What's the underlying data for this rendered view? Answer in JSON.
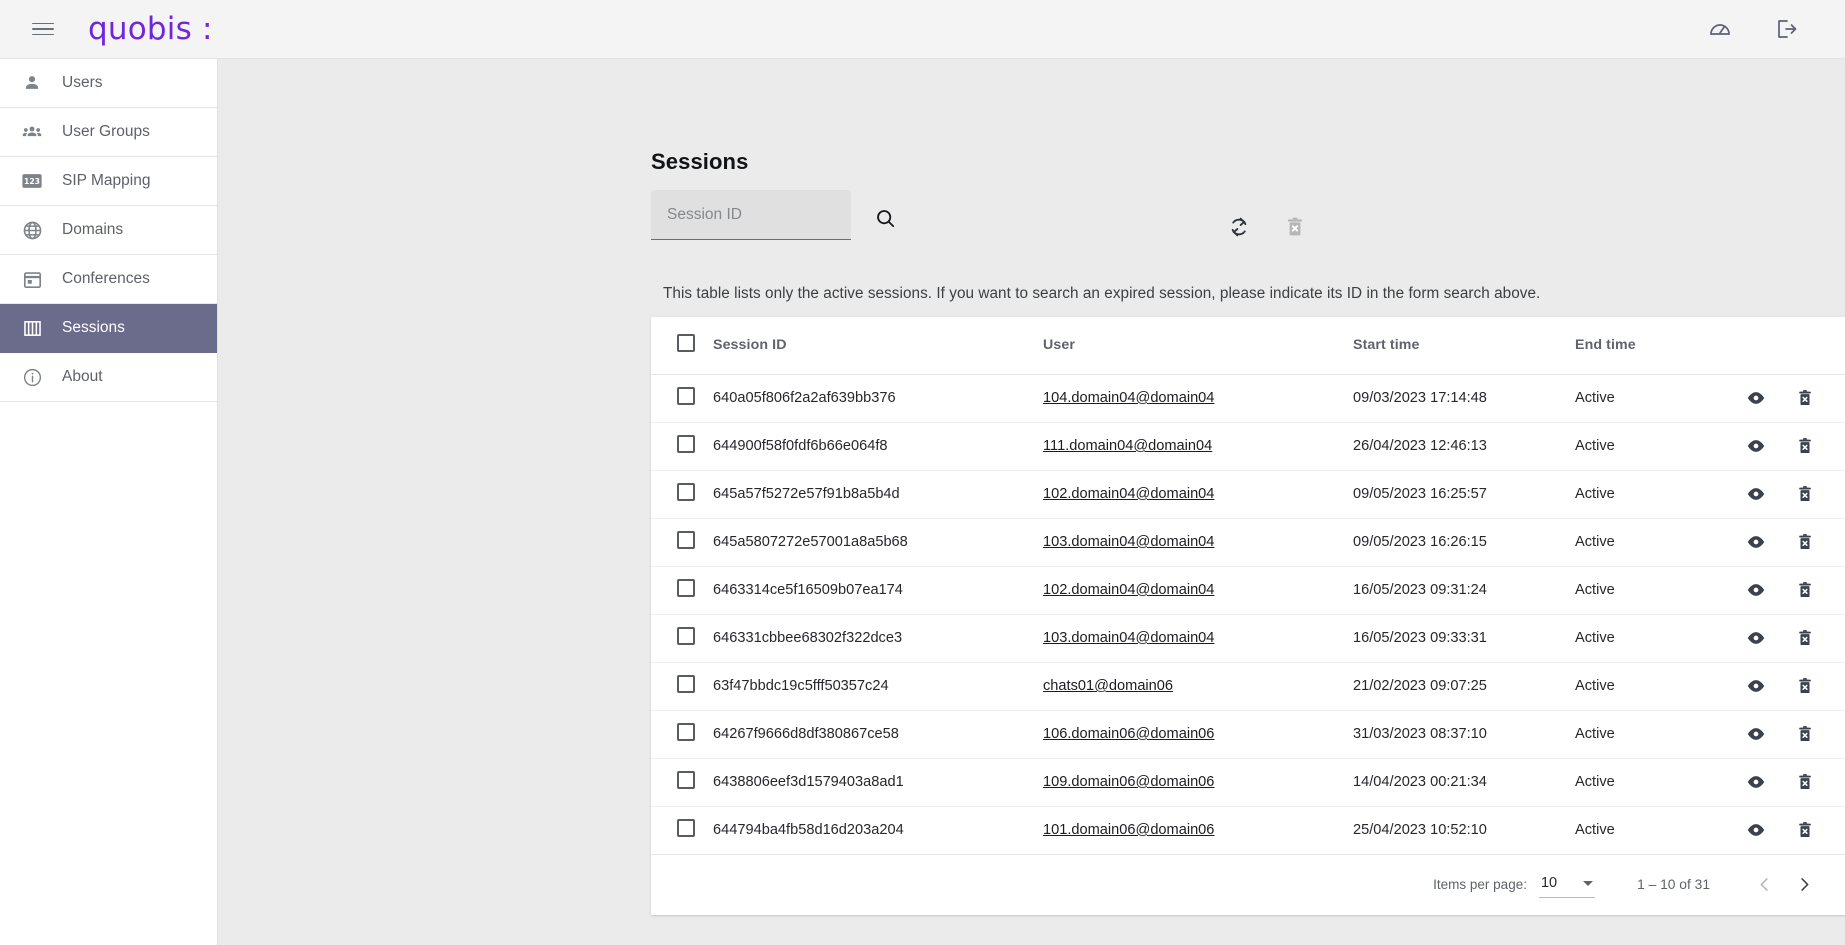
{
  "topbar": {
    "menu_icon": "hamburger-menu-icon",
    "brand": "quobis :",
    "icons": [
      {
        "name": "dashboard-gauge-icon",
        "label": "Dashboard"
      },
      {
        "name": "logout-icon",
        "label": "Logout"
      }
    ]
  },
  "sidebar": {
    "items": [
      {
        "label": "Users",
        "icon": "person-icon",
        "active": false
      },
      {
        "label": "User Groups",
        "icon": "people-group-icon",
        "active": false
      },
      {
        "label": "SIP Mapping",
        "icon": "numeric-123-icon",
        "active": false
      },
      {
        "label": "Domains",
        "icon": "globe-icon",
        "active": false
      },
      {
        "label": "Conferences",
        "icon": "calendar-icon",
        "active": false
      },
      {
        "label": "Sessions",
        "icon": "columns-icon",
        "active": true
      },
      {
        "label": "About",
        "icon": "info-circle-icon",
        "active": false
      }
    ]
  },
  "main": {
    "title": "Sessions",
    "search": {
      "placeholder": "Session ID",
      "value": "",
      "button_icon": "search-icon"
    },
    "toolbar": [
      {
        "name": "refresh-button",
        "icon": "refresh-icon",
        "disabled": false
      },
      {
        "name": "delete-selected-button",
        "icon": "trash-x-icon",
        "disabled": true
      }
    ],
    "info_text": "This table lists only the active sessions. If you want to search an expired session, please indicate its ID in the form search above.",
    "table": {
      "columns": [
        "Session ID",
        "User",
        "Start time",
        "End time"
      ],
      "rows": [
        {
          "session_id": "640a05f806f2a2af639bb376",
          "user": "104.domain04@domain04",
          "start_time": "09/03/2023 17:14:48",
          "end_time": "Active"
        },
        {
          "session_id": "644900f58f0fdf6b66e064f8",
          "user": "111.domain04@domain04",
          "start_time": "26/04/2023 12:46:13",
          "end_time": "Active"
        },
        {
          "session_id": "645a57f5272e57f91b8a5b4d",
          "user": "102.domain04@domain04",
          "start_time": "09/05/2023 16:25:57",
          "end_time": "Active"
        },
        {
          "session_id": "645a5807272e57001a8a5b68",
          "user": "103.domain04@domain04",
          "start_time": "09/05/2023 16:26:15",
          "end_time": "Active"
        },
        {
          "session_id": "6463314ce5f16509b07ea174",
          "user": "102.domain04@domain04",
          "start_time": "16/05/2023 09:31:24",
          "end_time": "Active"
        },
        {
          "session_id": "646331cbbee68302f322dce3",
          "user": "103.domain04@domain04",
          "start_time": "16/05/2023 09:33:31",
          "end_time": "Active"
        },
        {
          "session_id": "63f47bbdc19c5fff50357c24",
          "user": "chats01@domain06",
          "start_time": "21/02/2023 09:07:25",
          "end_time": "Active"
        },
        {
          "session_id": "64267f9666d8df380867ce58",
          "user": "106.domain06@domain06",
          "start_time": "31/03/2023 08:37:10",
          "end_time": "Active"
        },
        {
          "session_id": "6438806eef3d1579403a8ad1",
          "user": "109.domain06@domain06",
          "start_time": "14/04/2023 00:21:34",
          "end_time": "Active"
        },
        {
          "session_id": "644794ba4fb58d16d203a204",
          "user": "101.domain06@domain06",
          "start_time": "25/04/2023 10:52:10",
          "end_time": "Active"
        }
      ],
      "row_actions": [
        {
          "name": "view-session-button",
          "icon": "eye-icon"
        },
        {
          "name": "delete-session-button",
          "icon": "trash-x-icon"
        }
      ]
    },
    "paginator": {
      "items_per_page_label": "Items per page:",
      "items_per_page_value": "10",
      "range_label": "1 – 10 of 31",
      "prev_icon": "chevron-left-icon",
      "next_icon": "chevron-right-icon",
      "prev_disabled": true
    }
  },
  "colors": {
    "brand_purple": "#7126dd",
    "sidebar_active": "#6b6b8c",
    "page_bg": "#ebebeb",
    "card_bg": "#ffffff"
  }
}
